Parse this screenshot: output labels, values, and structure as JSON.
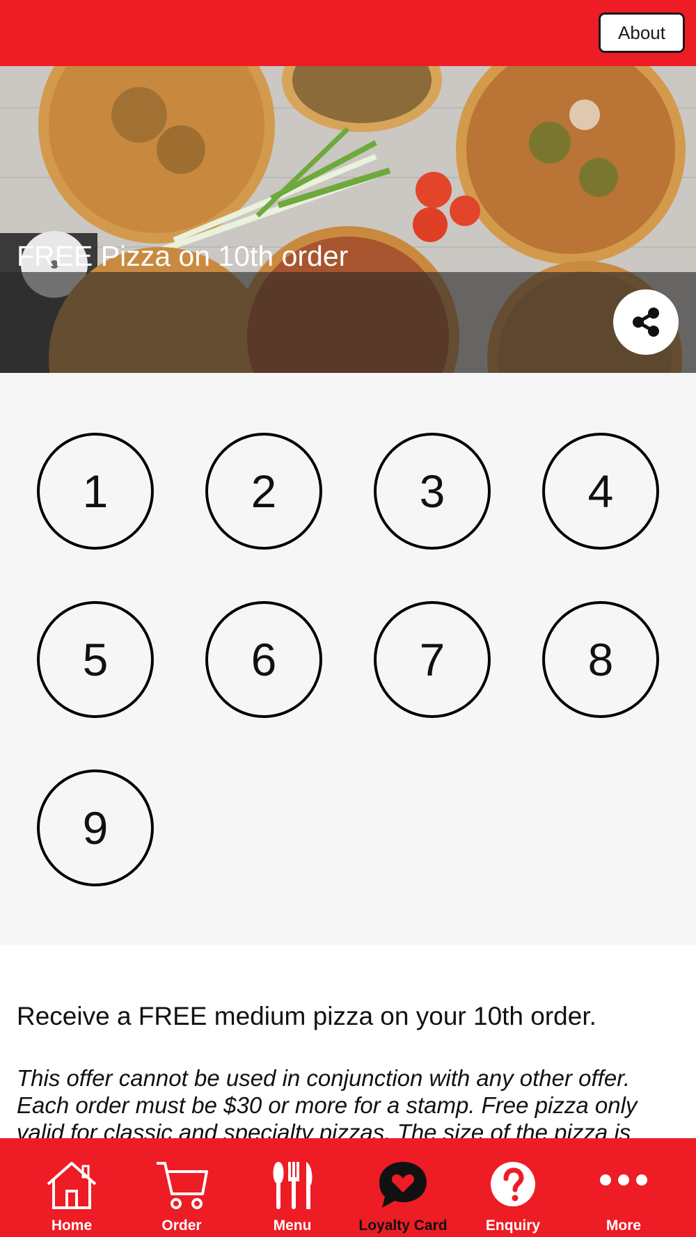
{
  "header": {
    "about_label": "About"
  },
  "hero": {
    "title": "FREE Pizza on 10th order"
  },
  "stamps": [
    "1",
    "2",
    "3",
    "4",
    "5",
    "6",
    "7",
    "8",
    "9"
  ],
  "description": {
    "main": "Receive a FREE medium pizza on your 10th order.",
    "terms": "This offer cannot be used in conjunction with any other offer. Each order must be $30 or more for a stamp. Free pizza only valid for classic and specialty pizzas. The size of the pizza is"
  },
  "nav": {
    "items": [
      {
        "label": "Home",
        "icon": "home-icon"
      },
      {
        "label": "Order",
        "icon": "cart-icon"
      },
      {
        "label": "Menu",
        "icon": "cutlery-icon"
      },
      {
        "label": "Loyalty Card",
        "icon": "heart-bubble-icon",
        "active": true
      },
      {
        "label": "Enquiry",
        "icon": "question-icon"
      },
      {
        "label": "More",
        "icon": "more-dots-icon"
      }
    ]
  },
  "colors": {
    "brand_red": "#ee1c25",
    "stamp_area_bg": "#f6f6f6"
  }
}
